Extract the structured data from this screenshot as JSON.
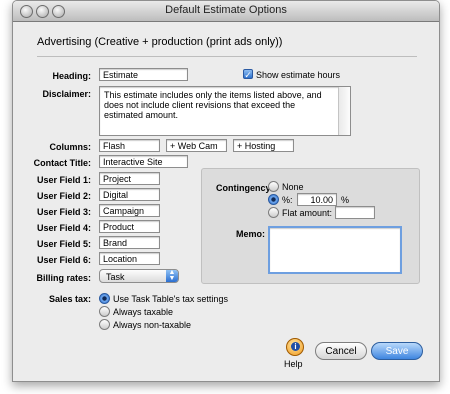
{
  "window": {
    "title": "Default Estimate Options"
  },
  "section_title": "Advertising (Creative + production (print ads only))",
  "heading": {
    "label": "Heading:",
    "value": "Estimate"
  },
  "show_hours": {
    "label": "Show estimate hours",
    "checked": true
  },
  "disclaimer": {
    "label": "Disclaimer:",
    "value": "This estimate includes only the items listed above, and does not include client revisions that exceed the estimated amount."
  },
  "columns": {
    "label": "Columns:",
    "values": [
      "Flash",
      "+ Web Cam",
      "+ Hosting"
    ]
  },
  "contact_title": {
    "label": "Contact Title:",
    "value": "Interactive Site"
  },
  "user_fields": [
    {
      "label": "User Field 1:",
      "value": "Project"
    },
    {
      "label": "User Field 2:",
      "value": "Digital"
    },
    {
      "label": "User Field 3:",
      "value": "Campaign"
    },
    {
      "label": "User Field 4:",
      "value": "Product"
    },
    {
      "label": "User Field 5:",
      "value": "Brand"
    },
    {
      "label": "User Field 6:",
      "value": "Location"
    }
  ],
  "billing_rates": {
    "label": "Billing rates:",
    "value": "Task"
  },
  "sales_tax": {
    "label": "Sales tax:",
    "options": [
      "Use Task Table's tax settings",
      "Always taxable",
      "Always non-taxable"
    ],
    "selected": 0
  },
  "contingency": {
    "label": "Contingency:",
    "options": [
      "None",
      "%:",
      "Flat amount:"
    ],
    "selected": 1,
    "percent_value": "10.00",
    "percent_suffix": "%",
    "flat_value": ""
  },
  "memo": {
    "label": "Memo:",
    "value": ""
  },
  "buttons": {
    "help": "Help",
    "cancel": "Cancel",
    "save": "Save"
  },
  "icons": {
    "help": "help-info-icon",
    "check": "checkmark-icon"
  }
}
